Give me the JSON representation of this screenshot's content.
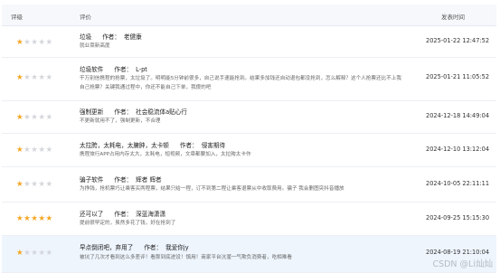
{
  "header": {
    "rating": "评级",
    "comment": "评价",
    "time": "发表时间"
  },
  "author_label": "作者：",
  "colors": {
    "star_on": "#f5a623",
    "star_off": "#d3d6db",
    "highlight": "#eef5fd"
  },
  "rows": [
    {
      "stars": 1,
      "title": "垃圾",
      "author": "老健康",
      "content": "就业菜新高度",
      "time": "2025-01-22 12:47:52"
    },
    {
      "stars": 1,
      "title": "垃圾软件",
      "author": "L-pt",
      "content": "干万别信携程的抢票，太垃圾了。明明能5分钟前很多，自己说手速能抢到。结果多加钱还自动退包都没抢到，怎么解释？这个人抢票还比不上我自己抢票？关键我通过程中，你还不能自己下单，我傻的吧",
      "time": "2025-01-21 11:05:52"
    },
    {
      "stars": 1,
      "title": "强制更新",
      "author": "社会稳流体a贴心行",
      "content": "不更新就用不了，强制更新，不合理",
      "time": "2024-12-18 14:49:04"
    },
    {
      "stars": 1,
      "title": "太拉胯，太耗电，太臃肿，太卡顿",
      "author": "侵害期待",
      "content": "携程旅行APP占用内存太大，太耗电，短视频，文章都要加入，太拉胯太卡作",
      "time": "2024-12-10 13:12:04"
    },
    {
      "stars": 1,
      "title": "骗子软件",
      "author": "辉者 辉者",
      "content": "为挣钱，抢机票巧让乘客买两程票，结果只给一程，订不到第二程让乘客退票从中收取费用。骗子 我会删图突抖音播放",
      "time": "2024-10-05 22:11:11"
    },
    {
      "stars": 5,
      "title": "还可以了",
      "author": "深蓝海潇潇",
      "content": "提前很早定的，虽然多花了钱，好在抢到了",
      "time": "2024-09-25 15:15:30"
    },
    {
      "stars": 1,
      "title": "早点倒闭吧，弃用了",
      "author": "我爱你jy",
      "content": "被坑了几次才看到这么多差评！看那到底进设！慎用！商家平台沆瀣一气欺负消费者，吃相难看",
      "time": "2024-08-19 21:10:04"
    }
  ],
  "watermark": "CSDN @Li灿灿"
}
